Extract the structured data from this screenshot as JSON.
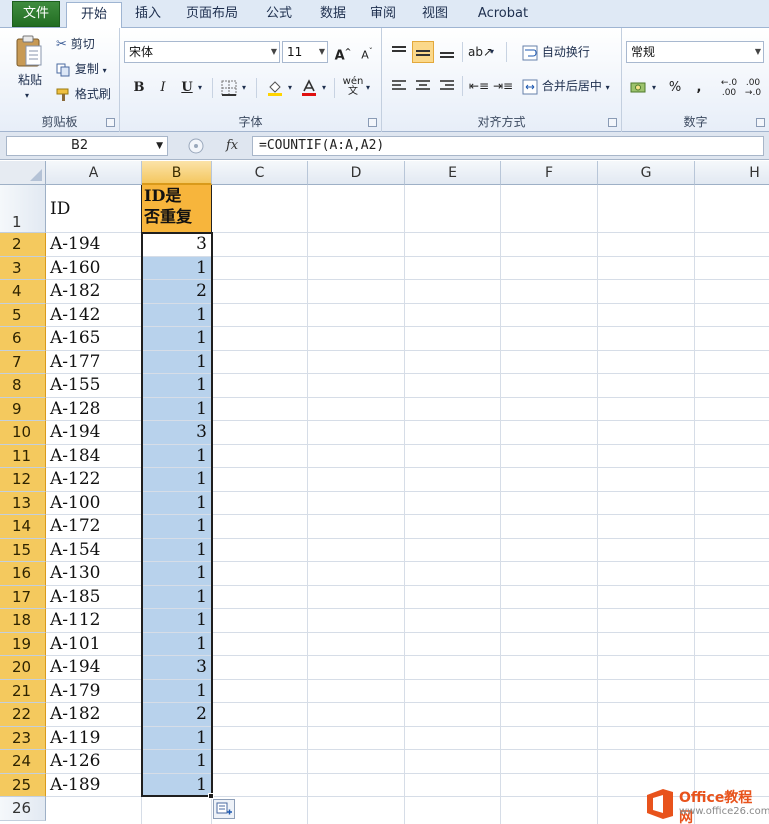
{
  "ribbon_tabs": [
    {
      "label": "文件",
      "kind": "file"
    },
    {
      "label": "开始",
      "kind": "active"
    },
    {
      "label": "插入",
      "kind": ""
    },
    {
      "label": "页面布局",
      "kind": ""
    },
    {
      "label": "公式",
      "kind": ""
    },
    {
      "label": "数据",
      "kind": ""
    },
    {
      "label": "审阅",
      "kind": ""
    },
    {
      "label": "视图",
      "kind": ""
    },
    {
      "label": "Acrobat",
      "kind": ""
    }
  ],
  "clipboard": {
    "paste_label": "粘贴",
    "cut_label": "剪切",
    "copy_label": "复制",
    "format_painter_label": "格式刷",
    "group_label": "剪贴板"
  },
  "font": {
    "font_name": "宋体",
    "font_size": "11",
    "group_label": "字体",
    "bold": "B",
    "italic": "I",
    "underline": "U",
    "grow": "A",
    "shrink": "A"
  },
  "alignment": {
    "wrap_text_label": "自动换行",
    "merge_center_label": "合并后居中",
    "group_label": "对齐方式"
  },
  "number": {
    "format_value": "常规",
    "percent": "%",
    "comma": ",",
    "group_label": "数字"
  },
  "formula_bar": {
    "name_box": "B2",
    "fx_label": "fx",
    "formula": "=COUNTIF(A:A,A2)"
  },
  "columns": [
    "A",
    "B",
    "C",
    "D",
    "E",
    "F",
    "G",
    "H"
  ],
  "selected_column": "B",
  "header_row": {
    "row": "1",
    "a": "ID",
    "b_line1": "ID是",
    "b_line2": "否重复"
  },
  "rows": [
    {
      "row": "2",
      "id": "A-194",
      "count": "3"
    },
    {
      "row": "3",
      "id": "A-160",
      "count": "1"
    },
    {
      "row": "4",
      "id": "A-182",
      "count": "2"
    },
    {
      "row": "5",
      "id": "A-142",
      "count": "1"
    },
    {
      "row": "6",
      "id": "A-165",
      "count": "1"
    },
    {
      "row": "7",
      "id": "A-177",
      "count": "1"
    },
    {
      "row": "8",
      "id": "A-155",
      "count": "1"
    },
    {
      "row": "9",
      "id": "A-128",
      "count": "1"
    },
    {
      "row": "10",
      "id": "A-194",
      "count": "3"
    },
    {
      "row": "11",
      "id": "A-184",
      "count": "1"
    },
    {
      "row": "12",
      "id": "A-122",
      "count": "1"
    },
    {
      "row": "13",
      "id": "A-100",
      "count": "1"
    },
    {
      "row": "14",
      "id": "A-172",
      "count": "1"
    },
    {
      "row": "15",
      "id": "A-154",
      "count": "1"
    },
    {
      "row": "16",
      "id": "A-130",
      "count": "1"
    },
    {
      "row": "17",
      "id": "A-185",
      "count": "1"
    },
    {
      "row": "18",
      "id": "A-112",
      "count": "1"
    },
    {
      "row": "19",
      "id": "A-101",
      "count": "1"
    },
    {
      "row": "20",
      "id": "A-194",
      "count": "3"
    },
    {
      "row": "21",
      "id": "A-179",
      "count": "1"
    },
    {
      "row": "22",
      "id": "A-182",
      "count": "2"
    },
    {
      "row": "23",
      "id": "A-119",
      "count": "1"
    },
    {
      "row": "24",
      "id": "A-126",
      "count": "1"
    },
    {
      "row": "25",
      "id": "A-189",
      "count": "1"
    }
  ],
  "last_row": "26",
  "watermark": {
    "brand": "Office教程网",
    "url": "www.office26.com"
  },
  "colors": {
    "selection_header": "#f4c95e",
    "header_b_fill": "#f7b53c",
    "selected_cells": "#b8d2ec",
    "file_tab": "#2f7d2f"
  }
}
